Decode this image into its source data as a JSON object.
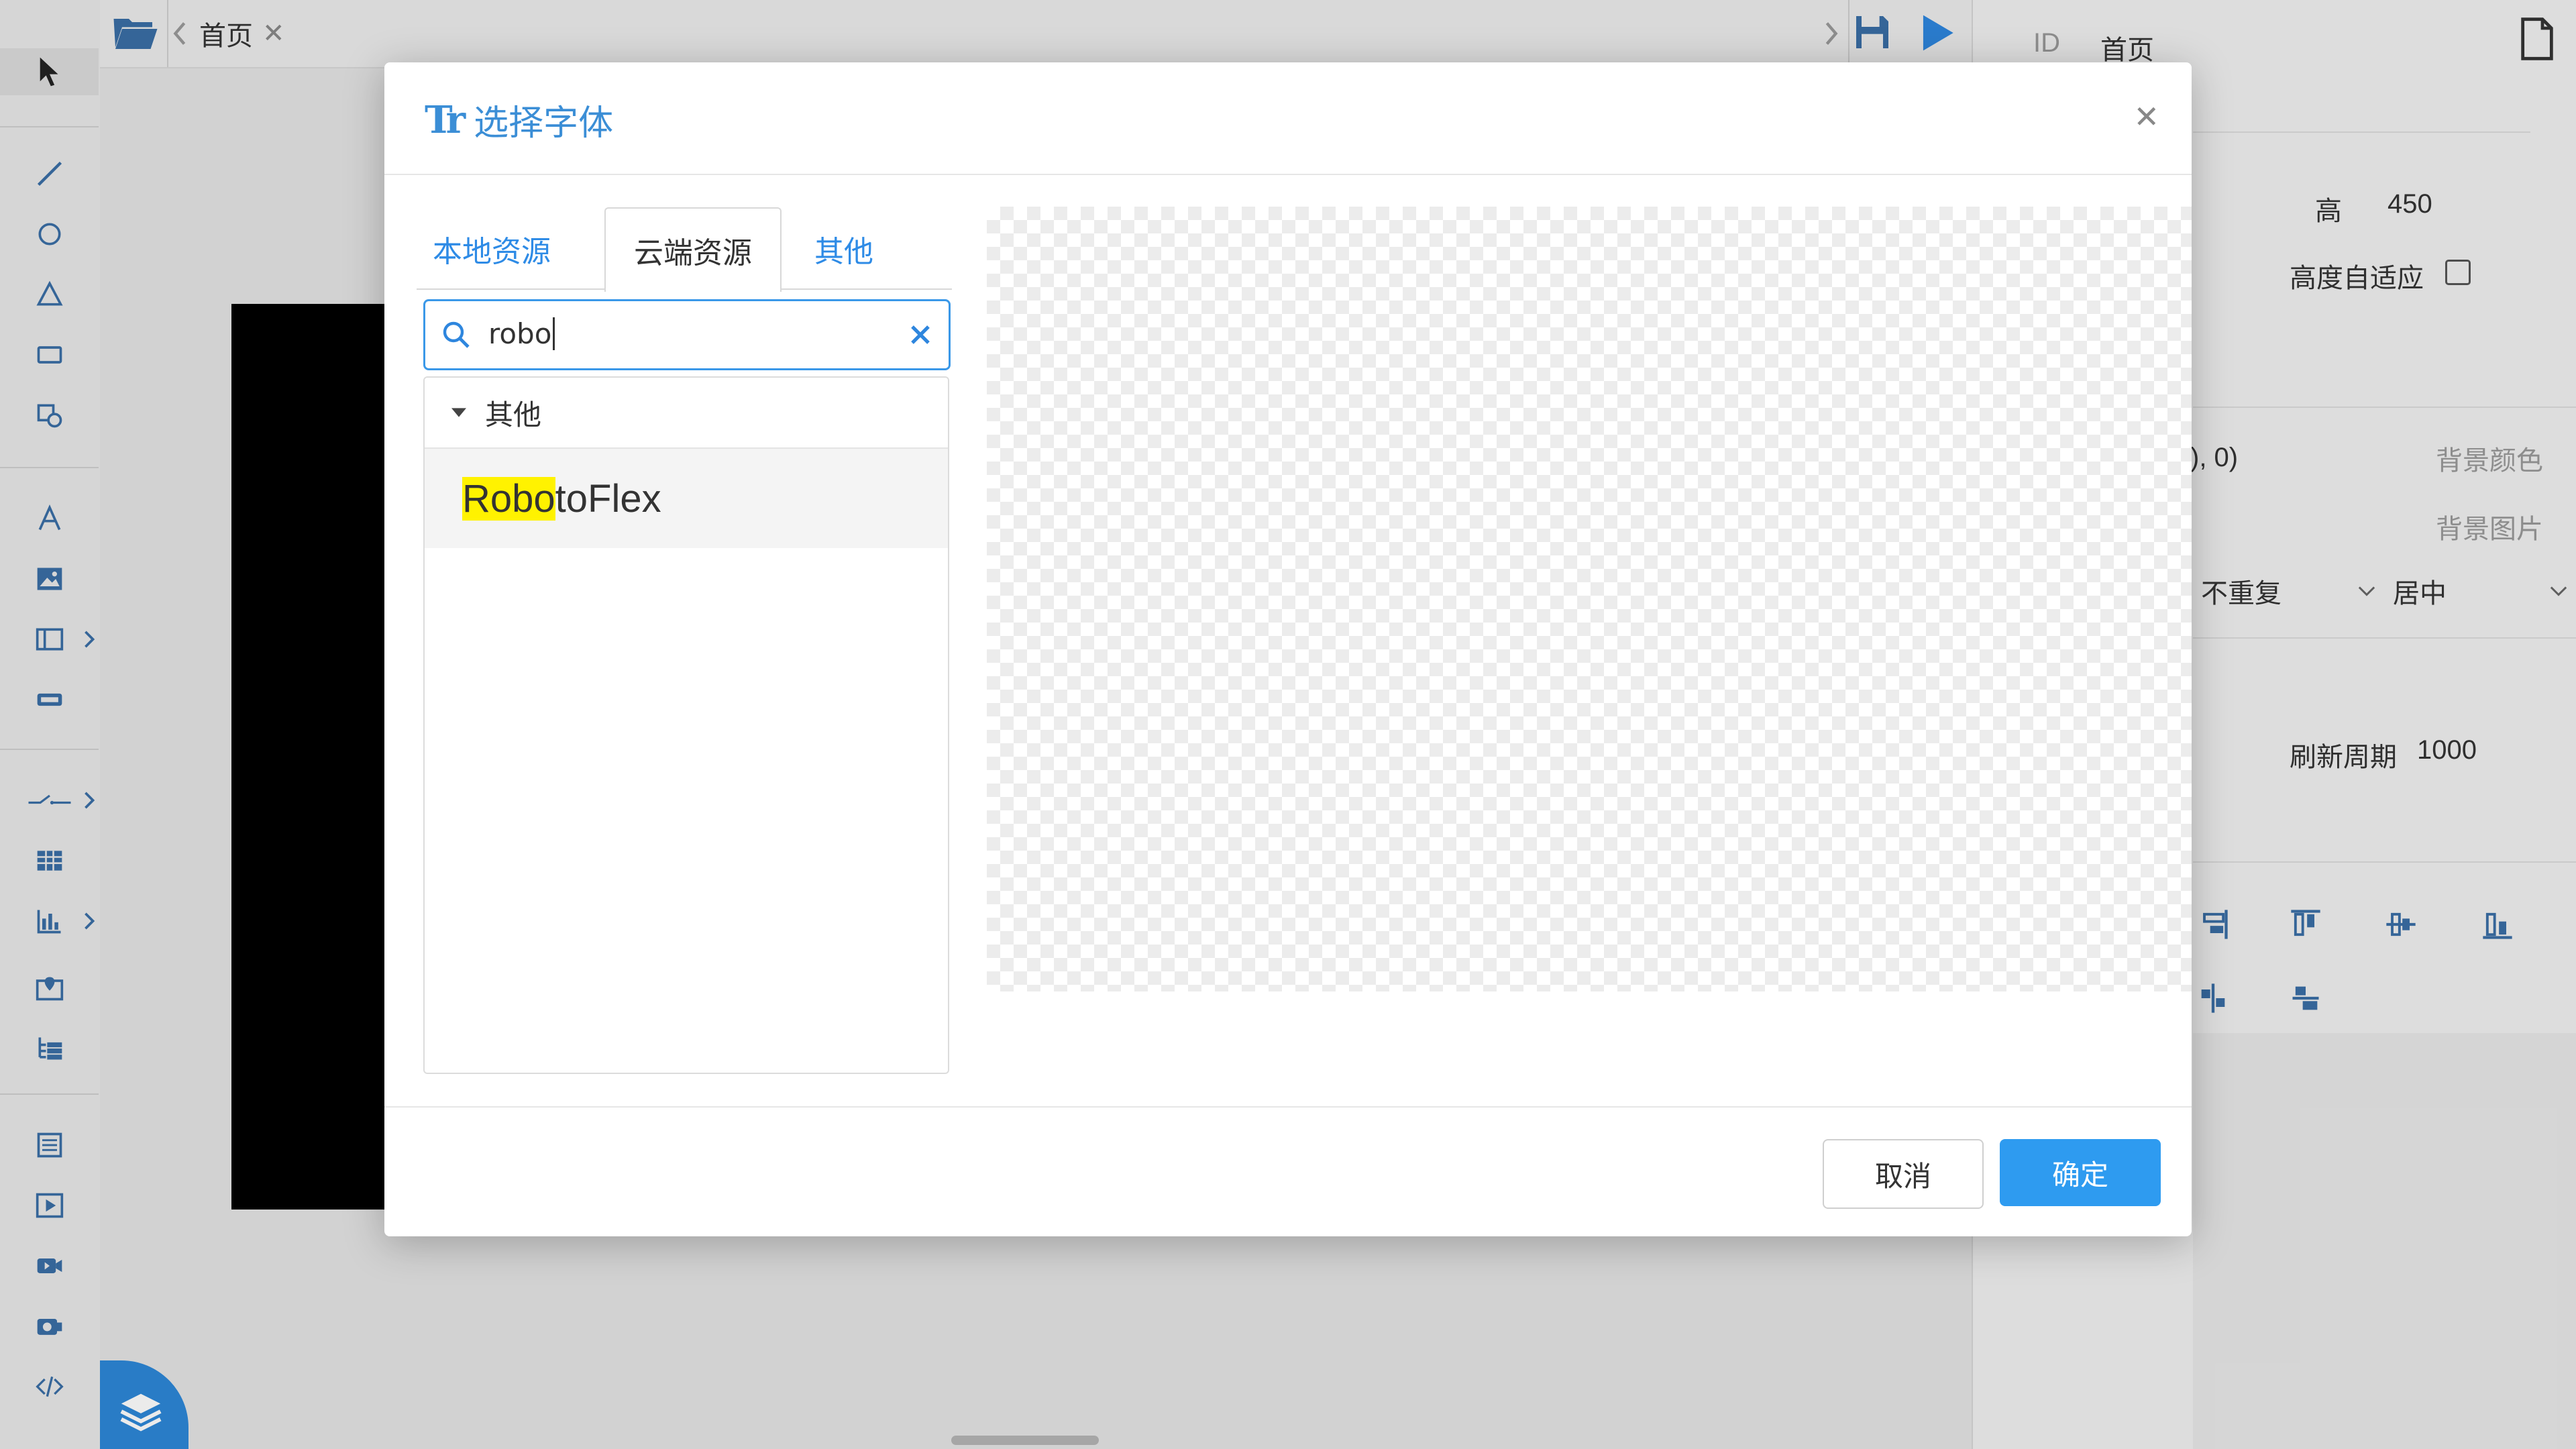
{
  "tabbar": {
    "tab_title": "首页"
  },
  "right_panel": {
    "id_label": "ID",
    "id_value": "首页",
    "height_label": "高",
    "height_value": "450",
    "auto_height_label": "高度自适应",
    "color_value_partial": "), 0)",
    "bg_color_label": "背景颜色",
    "bg_image_label": "背景图片",
    "repeat_value": "不重复",
    "position_value": "居中",
    "refresh_label": "刷新周期",
    "refresh_value": "1000"
  },
  "dialog": {
    "title": "选择字体",
    "tabs": [
      {
        "label": "本地资源",
        "active": false
      },
      {
        "label": "云端资源",
        "active": true
      },
      {
        "label": "其他",
        "active": false
      }
    ],
    "search": {
      "value": "robo"
    },
    "group": {
      "label": "其他"
    },
    "results": [
      {
        "highlight": "Robo",
        "rest": "toFlex"
      }
    ],
    "cancel_label": "取消",
    "confirm_label": "确定"
  },
  "colors": {
    "accent": "#2e9bf0",
    "highlight": "#fff200"
  }
}
